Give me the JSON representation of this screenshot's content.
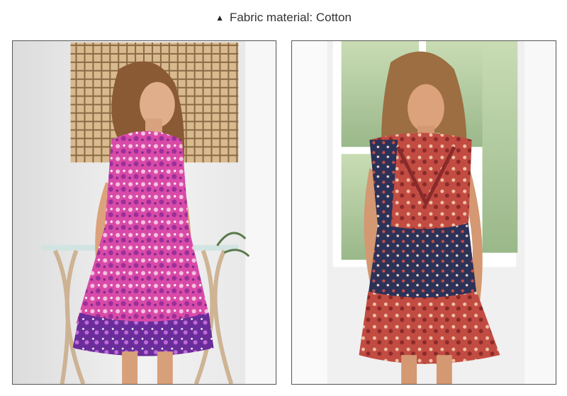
{
  "header": {
    "icon": "triangle-up-icon",
    "text": "Fabric material: Cotton"
  },
  "photos": [
    {
      "subject": "woman-purple-floral-dress"
    },
    {
      "subject": "woman-red-navy-floral-dress"
    }
  ],
  "colors": {
    "purple_dress": "#c0399a",
    "red_dress": "#c24c42",
    "navy": "#2c3158"
  }
}
